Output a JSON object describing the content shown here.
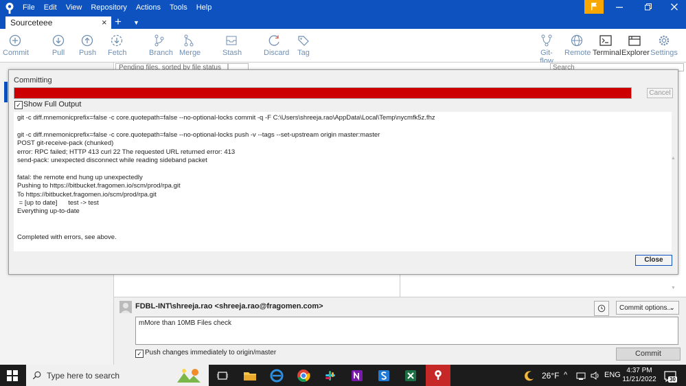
{
  "titlebar": {
    "menu": [
      "File",
      "Edit",
      "View",
      "Repository",
      "Actions",
      "Tools",
      "Help"
    ],
    "colors": {
      "titlebar": "#0d52bf",
      "flag": "#f7a700"
    }
  },
  "tabs": [
    {
      "label": "Sourceteee",
      "close": "×"
    }
  ],
  "tab_add": "+",
  "toolbar": {
    "left": [
      {
        "label": "Commit",
        "icon": "plus-circle-icon"
      },
      {
        "label": "Pull",
        "icon": "download-icon"
      },
      {
        "label": "Push",
        "icon": "upload-icon"
      },
      {
        "label": "Fetch",
        "icon": "fetch-icon"
      },
      {
        "label": "Branch",
        "icon": "branch-icon"
      },
      {
        "label": "Merge",
        "icon": "merge-icon"
      },
      {
        "label": "Stash",
        "icon": "stash-icon"
      },
      {
        "label": "Discard",
        "icon": "discard-icon"
      },
      {
        "label": "Tag",
        "icon": "tag-icon"
      }
    ],
    "right": [
      {
        "label": "Git-flow",
        "icon": "gitflow-icon"
      },
      {
        "label": "Remote",
        "icon": "globe-icon"
      },
      {
        "label": "Terminal",
        "icon": "terminal-icon"
      },
      {
        "label": "Explorer",
        "icon": "explorer-icon"
      },
      {
        "label": "Settings",
        "icon": "gear-icon"
      }
    ]
  },
  "filter": {
    "value": "Pending files, sorted by file status"
  },
  "search": {
    "placeholder": "Search"
  },
  "dialog": {
    "title": "Committing",
    "progress_color": "#cc0000",
    "cancel_label": "Cancel",
    "show_full_output_label": "Show Full Output",
    "show_full_output_checked": true,
    "output": "git -c diff.mnemonicprefix=false -c core.quotepath=false --no-optional-locks commit -q -F C:\\Users\\shreeja.rao\\AppData\\Local\\Temp\\nycmfk5z.fhz\n\ngit -c diff.mnemonicprefix=false -c core.quotepath=false --no-optional-locks push -v --tags --set-upstream origin master:master\nPOST git-receive-pack (chunked)\nerror: RPC failed; HTTP 413 curl 22 The requested URL returned error: 413\nsend-pack: unexpected disconnect while reading sideband packet\n\nfatal: the remote end hung up unexpectedly\nPushing to https://bitbucket.fragomen.io/scm/prod/rpa.git\nTo https://bitbucket.fragomen.io/scm/prod/rpa.git\n = [up to date]      test -> test\nEverything up-to-date\n\n\nCompleted with errors, see above.",
    "close_label": "Close"
  },
  "commit": {
    "author": "FDBL-INT\\shreeja.rao <shreeja.rao@fragomen.com>",
    "options_label": "Commit options...",
    "message": "mMore than 10MB Files check",
    "push_label": "Push changes immediately to origin/master",
    "push_checked": true,
    "commit_label": "Commit"
  },
  "taskbar": {
    "search_placeholder": "Type here to search",
    "weather": "26°F",
    "language": "ENG",
    "time": "4:37 PM",
    "date": "11/21/2022",
    "notifications": "30"
  }
}
